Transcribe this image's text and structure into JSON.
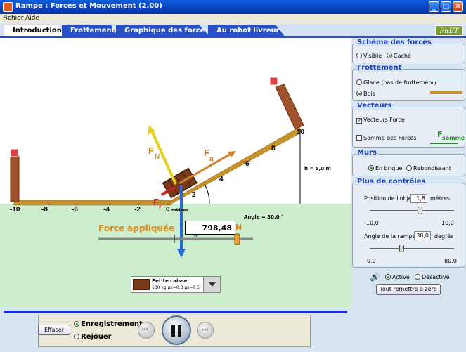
{
  "window": {
    "title": "Rampe : Forces et Mouvement (2.00)",
    "min": "_",
    "max": "□",
    "close": "✕"
  },
  "menu": [
    "Fichier",
    "Aide"
  ],
  "tabs": [
    "Introduction",
    "Frottement",
    "Graphique des forces",
    "Au robot livreur"
  ],
  "logo": "PhET",
  "scene": {
    "ticks": [
      "-10",
      "-8",
      "-6",
      "-4",
      "-2",
      "0",
      "2",
      "4",
      "6",
      "8",
      "10"
    ],
    "metres": "mètres",
    "height_label": "h = 5,0 m",
    "angle_label": "Angle = 30,0 °",
    "vector_labels": {
      "normal": "F",
      "normal_sub": "N",
      "applied": "F",
      "applied_sub": "a",
      "friction": "F",
      "friction_sub": "f",
      "gravity": "F",
      "gravity_sub": "g"
    },
    "applied_force_label": "Force appliquée",
    "applied_force_value": "798,48",
    "applied_force_unit": "N",
    "object": {
      "name": "Petite caisse",
      "desc": "100 kg μk=0.3 μs=0.5"
    },
    "colors": {
      "sky": "#ffffff",
      "ground": "#cdeecd",
      "ramp": "#c8922a",
      "normal": "#e8d020",
      "applied": "#d0802a",
      "gravity": "#2a6ad8",
      "friction": "#c82020"
    }
  },
  "panels": {
    "schema": {
      "title": "Schéma des forces",
      "visible": "Visible",
      "cache": "Caché",
      "selected": "cache"
    },
    "frottement": {
      "title": "Frottement",
      "glace": "Glace (pas de frottement)",
      "bois": "Bois",
      "selected": "bois"
    },
    "vecteurs": {
      "title": "Vecteurs",
      "force": "Vecteurs Force",
      "somme": "Somme des Forces",
      "force_checked": true,
      "somme_checked": false,
      "somme_symbol": "F",
      "somme_sub": "somme"
    },
    "murs": {
      "title": "Murs",
      "brique": "En brique",
      "rebond": "Rebondissant",
      "selected": "brique"
    },
    "controles": {
      "title": "Plus de contrôles",
      "position_label": "Position de l'objet",
      "position_value": "1,8",
      "position_unit": "mètres",
      "position_min": "-10,0",
      "position_max": "10,0",
      "position_fraction": 0.59,
      "angle_label": "Angle de la rampe",
      "angle_value": "30,0",
      "angle_unit": "degrés",
      "angle_min": "0,0",
      "angle_max": "80,0",
      "angle_fraction": 0.375
    },
    "sound": {
      "active": "Activé",
      "desactive": "Désactivé",
      "selected": "active"
    },
    "reset": "Tout remettre à zéro"
  },
  "bottom": {
    "effacer": "Effacer",
    "enregistrement": "Enregistrement",
    "rejouer": "Rejouer",
    "selected": "enregistrement"
  }
}
